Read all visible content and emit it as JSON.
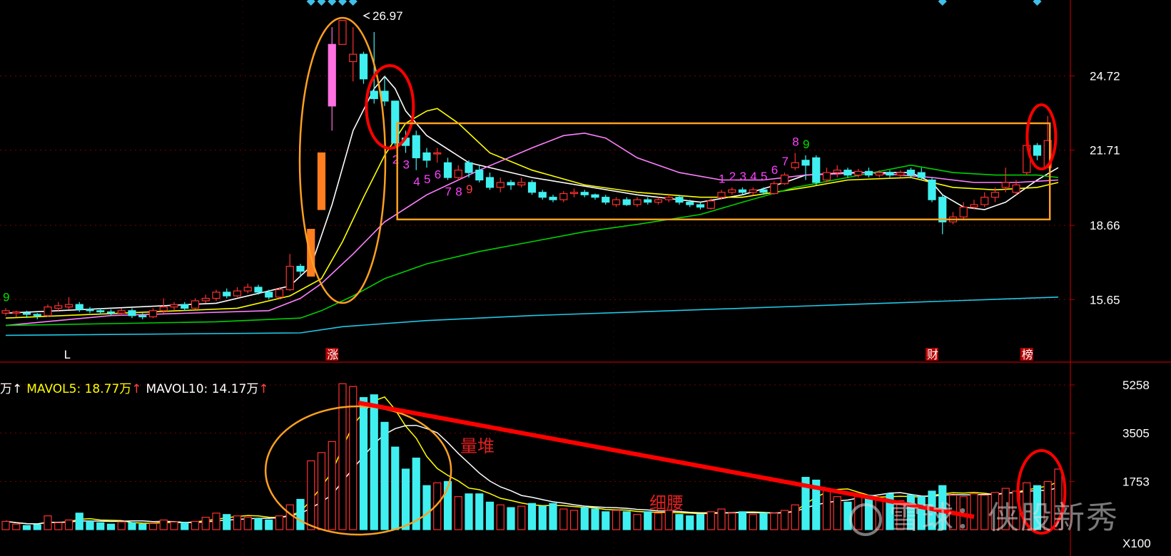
{
  "chart_data": {
    "type": "candlestick",
    "price_axis": {
      "ticks": [
        24.72,
        21.71,
        18.66,
        15.65
      ],
      "range": [
        13.2,
        27.8
      ]
    },
    "peak_label": "26.97",
    "event_markers": [
      "L",
      "涨",
      "财",
      "榜"
    ],
    "candles": [
      [
        15.1,
        15.2,
        15.0,
        15.3
      ],
      [
        15.1,
        15.15,
        14.95,
        15.2
      ],
      [
        15.1,
        15.05,
        14.9,
        15.2
      ],
      [
        15.05,
        15.0,
        14.85,
        15.1
      ],
      [
        15.0,
        15.35,
        14.95,
        15.45
      ],
      [
        15.3,
        15.4,
        15.2,
        15.55
      ],
      [
        15.35,
        15.45,
        15.25,
        15.75
      ],
      [
        15.45,
        15.25,
        15.15,
        15.55
      ],
      [
        15.25,
        15.2,
        15.1,
        15.35
      ],
      [
        15.2,
        15.15,
        15.05,
        15.3
      ],
      [
        15.15,
        15.1,
        15.0,
        15.25
      ],
      [
        15.1,
        15.2,
        15.0,
        15.3
      ],
      [
        15.2,
        15.0,
        14.9,
        15.3
      ],
      [
        15.0,
        14.95,
        14.85,
        15.1
      ],
      [
        14.95,
        15.2,
        14.9,
        15.3
      ],
      [
        15.2,
        15.35,
        15.1,
        15.7
      ],
      [
        15.35,
        15.45,
        15.2,
        15.55
      ],
      [
        15.45,
        15.3,
        15.2,
        15.55
      ],
      [
        15.3,
        15.6,
        15.25,
        15.7
      ],
      [
        15.6,
        15.7,
        15.5,
        15.85
      ],
      [
        15.7,
        15.95,
        15.6,
        16.05
      ],
      [
        15.95,
        15.8,
        15.7,
        16.1
      ],
      [
        15.8,
        16.0,
        15.75,
        16.15
      ],
      [
        16.0,
        16.15,
        15.9,
        16.3
      ],
      [
        16.15,
        15.95,
        15.85,
        16.25
      ],
      [
        15.95,
        15.75,
        15.65,
        16.05
      ],
      [
        15.75,
        16.05,
        15.7,
        16.15
      ],
      [
        16.05,
        17.0,
        16.0,
        17.5
      ],
      [
        17.0,
        16.8,
        16.6,
        17.1
      ],
      [
        16.6,
        18.5,
        16.6,
        18.5
      ],
      [
        19.3,
        21.6,
        19.3,
        21.6
      ],
      [
        23.5,
        26.0,
        22.5,
        26.7
      ],
      [
        26.0,
        26.97,
        26.0,
        26.97
      ],
      [
        25.3,
        25.6,
        24.5,
        26.7
      ],
      [
        25.6,
        24.6,
        24.4,
        25.7
      ],
      [
        24.1,
        23.8,
        23.6,
        26.5
      ],
      [
        24.1,
        23.7,
        23.5,
        24.7
      ],
      [
        23.7,
        22.0,
        21.8,
        23.7
      ],
      [
        22.2,
        21.9,
        21.6,
        22.5
      ],
      [
        22.3,
        21.4,
        20.9,
        22.5
      ],
      [
        21.6,
        21.3,
        21.0,
        21.8
      ],
      [
        21.6,
        21.6,
        21.2,
        21.8
      ],
      [
        21.2,
        20.6,
        20.5,
        21.4
      ],
      [
        20.6,
        20.9,
        20.5,
        21.1
      ],
      [
        21.2,
        20.8,
        20.6,
        21.3
      ],
      [
        20.9,
        20.5,
        20.4,
        21.1
      ],
      [
        20.6,
        20.2,
        20.1,
        20.8
      ],
      [
        20.2,
        20.4,
        20.0,
        20.6
      ],
      [
        20.4,
        20.3,
        20.1,
        20.5
      ],
      [
        20.3,
        20.4,
        20.2,
        20.6
      ],
      [
        20.4,
        20.0,
        19.9,
        20.5
      ],
      [
        20.0,
        19.8,
        19.7,
        20.1
      ],
      [
        19.8,
        19.7,
        19.6,
        19.9
      ],
      [
        19.7,
        19.95,
        19.6,
        20.05
      ],
      [
        19.95,
        20.0,
        19.8,
        20.15
      ],
      [
        20.0,
        19.9,
        19.8,
        20.1
      ],
      [
        19.9,
        19.8,
        19.7,
        19.95
      ],
      [
        19.8,
        19.6,
        19.5,
        19.9
      ],
      [
        19.5,
        19.7,
        19.4,
        19.8
      ],
      [
        19.7,
        19.5,
        19.45,
        19.8
      ],
      [
        19.5,
        19.7,
        19.4,
        19.8
      ],
      [
        19.7,
        19.6,
        19.5,
        19.8
      ],
      [
        19.6,
        19.7,
        19.5,
        19.8
      ],
      [
        19.7,
        19.8,
        19.6,
        19.9
      ],
      [
        19.8,
        19.6,
        19.5,
        19.9
      ],
      [
        19.6,
        19.5,
        19.4,
        19.7
      ],
      [
        19.5,
        19.4,
        19.3,
        19.6
      ],
      [
        19.35,
        19.65,
        19.3,
        19.75
      ],
      [
        19.8,
        20.0,
        19.7,
        20.1
      ],
      [
        20.0,
        20.1,
        19.9,
        20.2
      ],
      [
        20.1,
        20.0,
        19.9,
        20.2
      ],
      [
        20.0,
        20.1,
        19.9,
        20.2
      ],
      [
        20.1,
        20.0,
        19.9,
        20.2
      ],
      [
        19.95,
        20.35,
        19.9,
        20.45
      ],
      [
        20.35,
        20.7,
        20.3,
        20.8
      ],
      [
        21.0,
        21.2,
        20.9,
        21.6
      ],
      [
        21.3,
        21.1,
        20.5,
        21.5
      ],
      [
        21.4,
        20.4,
        20.3,
        21.5
      ],
      [
        20.5,
        20.8,
        20.4,
        21.0
      ],
      [
        20.8,
        20.9,
        20.6,
        21.1
      ],
      [
        20.9,
        20.7,
        20.6,
        21.0
      ],
      [
        20.7,
        20.85,
        20.6,
        20.95
      ],
      [
        20.85,
        20.7,
        20.6,
        21.0
      ],
      [
        20.7,
        20.8,
        20.6,
        20.9
      ],
      [
        20.8,
        20.7,
        20.6,
        20.9
      ],
      [
        20.7,
        20.8,
        20.6,
        20.9
      ],
      [
        20.9,
        20.7,
        20.6,
        21.0
      ],
      [
        20.8,
        20.6,
        20.5,
        21.0
      ],
      [
        20.5,
        19.7,
        19.6,
        20.6
      ],
      [
        19.8,
        18.8,
        18.3,
        19.9
      ],
      [
        18.8,
        19.0,
        18.7,
        19.2
      ],
      [
        19.0,
        19.4,
        18.9,
        19.6
      ],
      [
        19.4,
        19.5,
        19.3,
        19.7
      ],
      [
        19.5,
        19.8,
        19.4,
        20.0
      ],
      [
        19.8,
        20.0,
        19.6,
        20.2
      ],
      [
        20.2,
        20.4,
        20.0,
        21.0
      ],
      [
        20.0,
        20.3,
        19.9,
        20.5
      ],
      [
        20.8,
        21.9,
        20.7,
        22.0
      ],
      [
        21.9,
        21.5,
        21.3,
        22.0
      ],
      [
        21.0,
        22.1,
        21.0,
        23.1
      ]
    ],
    "sequence_labels": [
      {
        "text": "9",
        "i": 0,
        "at": "above",
        "color": "#00e000"
      },
      {
        "text": "2",
        "i": 37,
        "at": "below",
        "color": "#ff40ff"
      },
      {
        "text": "3",
        "i": 38,
        "at": "below",
        "color": "#ff40ff"
      },
      {
        "text": "4",
        "i": 39,
        "at": "below",
        "color": "#ff40ff"
      },
      {
        "text": "5",
        "i": 40,
        "at": "below",
        "color": "#ff40ff"
      },
      {
        "text": "6",
        "i": 41,
        "at": "below",
        "color": "#ff40ff"
      },
      {
        "text": "7",
        "i": 42,
        "at": "below",
        "color": "#ff40ff"
      },
      {
        "text": "8",
        "i": 43,
        "at": "below",
        "color": "#ff40ff"
      },
      {
        "text": "9",
        "i": 44,
        "at": "below",
        "color": "#ff4040"
      },
      {
        "text": "1",
        "i": 68,
        "at": "above",
        "color": "#ff40ff"
      },
      {
        "text": "2",
        "i": 69,
        "at": "above",
        "color": "#ff40ff"
      },
      {
        "text": "3",
        "i": 70,
        "at": "above",
        "color": "#ff40ff"
      },
      {
        "text": "4",
        "i": 71,
        "at": "above",
        "color": "#ff40ff"
      },
      {
        "text": "5",
        "i": 72,
        "at": "above",
        "color": "#ff40ff"
      },
      {
        "text": "6",
        "i": 73,
        "at": "above",
        "color": "#ff40ff"
      },
      {
        "text": "7",
        "i": 74,
        "at": "above",
        "color": "#ff40ff"
      },
      {
        "text": "8",
        "i": 75,
        "at": "above",
        "color": "#ff40ff"
      },
      {
        "text": "9",
        "i": 76,
        "at": "above",
        "color": "#00e000"
      }
    ],
    "ma_lines": [
      {
        "color": "#ffffff",
        "pts": [
          [
            0,
            15.1
          ],
          [
            20,
            15.5
          ],
          [
            27,
            16.2
          ],
          [
            29,
            17.0
          ],
          [
            31,
            19.5
          ],
          [
            33,
            22.5
          ],
          [
            35,
            24.2
          ],
          [
            36,
            24.7
          ],
          [
            37,
            24.2
          ],
          [
            38,
            23.3
          ],
          [
            40,
            22.3
          ],
          [
            44,
            21.2
          ],
          [
            50,
            20.6
          ],
          [
            60,
            19.9
          ],
          [
            66,
            19.6
          ],
          [
            70,
            19.9
          ],
          [
            74,
            20.4
          ],
          [
            76,
            20.7
          ],
          [
            80,
            20.8
          ],
          [
            86,
            20.8
          ],
          [
            88,
            20.4
          ],
          [
            89,
            19.9
          ],
          [
            91,
            19.4
          ],
          [
            93,
            19.3
          ],
          [
            95,
            19.6
          ],
          [
            98,
            20.5
          ],
          [
            100,
            21.0
          ]
        ]
      },
      {
        "color": "#ffff00",
        "pts": [
          [
            0,
            14.9
          ],
          [
            22,
            15.3
          ],
          [
            27,
            15.8
          ],
          [
            30,
            16.5
          ],
          [
            32,
            18.0
          ],
          [
            34,
            19.8
          ],
          [
            36,
            21.5
          ],
          [
            38,
            22.8
          ],
          [
            40,
            23.3
          ],
          [
            41,
            23.4
          ],
          [
            43,
            22.8
          ],
          [
            46,
            21.6
          ],
          [
            50,
            20.9
          ],
          [
            55,
            20.3
          ],
          [
            60,
            20.0
          ],
          [
            66,
            19.8
          ],
          [
            70,
            19.8
          ],
          [
            76,
            20.2
          ],
          [
            80,
            20.5
          ],
          [
            86,
            20.6
          ],
          [
            90,
            20.2
          ],
          [
            94,
            20.1
          ],
          [
            98,
            20.2
          ],
          [
            100,
            20.4
          ]
        ]
      },
      {
        "color": "#ff80ff",
        "pts": [
          [
            0,
            14.6
          ],
          [
            10,
            15.0
          ],
          [
            25,
            15.2
          ],
          [
            28,
            15.7
          ],
          [
            30,
            16.3
          ],
          [
            33,
            17.5
          ],
          [
            36,
            18.8
          ],
          [
            40,
            19.9
          ],
          [
            45,
            20.9
          ],
          [
            50,
            21.8
          ],
          [
            53,
            22.3
          ],
          [
            55,
            22.4
          ],
          [
            57,
            22.2
          ],
          [
            60,
            21.4
          ],
          [
            64,
            20.8
          ],
          [
            68,
            20.5
          ],
          [
            72,
            20.5
          ],
          [
            76,
            20.7
          ],
          [
            82,
            20.8
          ],
          [
            88,
            20.6
          ],
          [
            92,
            20.4
          ],
          [
            96,
            20.4
          ],
          [
            100,
            20.5
          ]
        ]
      },
      {
        "color": "#00d000",
        "pts": [
          [
            0,
            14.6
          ],
          [
            20,
            14.75
          ],
          [
            28,
            14.9
          ],
          [
            30,
            15.2
          ],
          [
            33,
            15.8
          ],
          [
            36,
            16.5
          ],
          [
            40,
            17.1
          ],
          [
            45,
            17.6
          ],
          [
            50,
            18.0
          ],
          [
            55,
            18.4
          ],
          [
            60,
            18.7
          ],
          [
            66,
            19.1
          ],
          [
            70,
            19.6
          ],
          [
            75,
            20.2
          ],
          [
            80,
            20.6
          ],
          [
            86,
            21.1
          ],
          [
            90,
            20.8
          ],
          [
            94,
            20.7
          ],
          [
            98,
            20.7
          ],
          [
            100,
            20.6
          ]
        ]
      },
      {
        "color": "#20c8e8",
        "pts": [
          [
            0,
            14.2
          ],
          [
            28,
            14.3
          ],
          [
            32,
            14.55
          ],
          [
            40,
            14.8
          ],
          [
            50,
            15.0
          ],
          [
            60,
            15.15
          ],
          [
            70,
            15.3
          ],
          [
            80,
            15.45
          ],
          [
            90,
            15.6
          ],
          [
            100,
            15.75
          ]
        ]
      }
    ],
    "legend": [
      {
        "text": "万↑",
        "color": "#ffffff",
        "arrow": "#ff4040"
      },
      {
        "text": "MAVOL5: 18.77万",
        "color": "#ffff00",
        "arrow": "#ff4040"
      },
      {
        "text": "MAVOL10: 14.17万",
        "color": "#ffffff",
        "arrow": "#ff4040"
      }
    ],
    "volume_axis": {
      "ticks": [
        5258,
        3505,
        1753
      ],
      "unit": "X100",
      "range": [
        0,
        5258
      ]
    },
    "volume": [
      300,
      200,
      150,
      180,
      500,
      250,
      350,
      600,
      300,
      250,
      200,
      280,
      250,
      200,
      220,
      350,
      280,
      250,
      300,
      450,
      600,
      550,
      500,
      450,
      400,
      350,
      500,
      900,
      1100,
      2500,
      2800,
      3200,
      5300,
      5200,
      4800,
      4900,
      3900,
      3000,
      2200,
      2600,
      1600,
      1700,
      1750,
      1200,
      1300,
      1300,
      1000,
      900,
      800,
      850,
      950,
      850,
      950,
      750,
      700,
      800,
      750,
      650,
      700,
      650,
      550,
      650,
      600,
      700,
      550,
      500,
      550,
      650,
      750,
      600,
      650,
      550,
      600,
      600,
      700,
      900,
      1900,
      1800,
      1500,
      1200,
      1000,
      1300,
      1250,
      1150,
      1300,
      1050,
      1250,
      1200,
      1400,
      1600,
      1250,
      1200,
      1300,
      1250,
      1350,
      1500,
      1400,
      1700,
      1600,
      1750,
      2200
    ]
  },
  "annotations": {
    "volume_pile": "量堆",
    "thin_waist": "细腰"
  },
  "watermark": {
    "text": "雪球：侠股新秀"
  },
  "colors": {
    "up": "#ff3030",
    "down": "#40f0f0",
    "limit_up": "#ff7f20",
    "spike": "#ff70e0",
    "highlight_orange": "#ffa020",
    "highlight_red": "#ff0000",
    "grid": "#7a0000"
  }
}
